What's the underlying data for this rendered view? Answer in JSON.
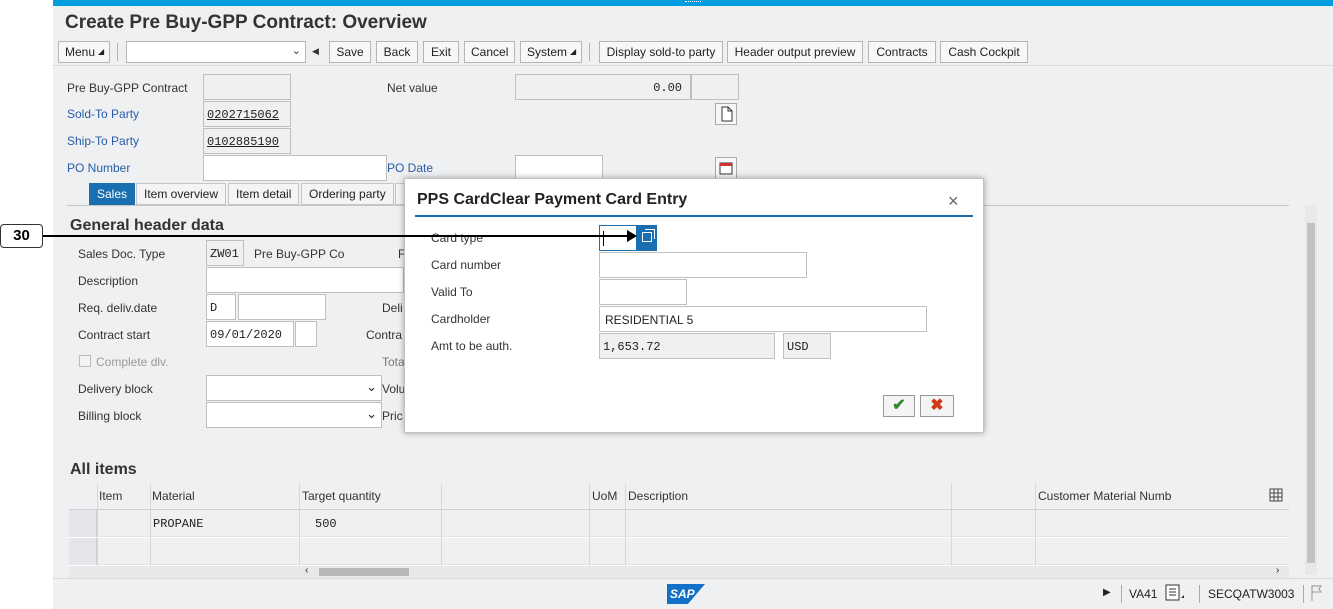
{
  "window": {
    "title": "Create Pre Buy-GPP Contract: Overview"
  },
  "toolbar": {
    "menu_label": "Menu",
    "save_label": "Save",
    "back_label": "Back",
    "exit_label": "Exit",
    "cancel_label": "Cancel",
    "system_label": "System",
    "display_sold_to_label": "Display sold-to party",
    "header_output_label": "Header output preview",
    "contracts_label": "Contracts",
    "cash_cockpit_label": "Cash Cockpit"
  },
  "header": {
    "contract_label": "Pre Buy-GPP Contract",
    "contract_value": "",
    "net_value_label": "Net value",
    "net_value": "0.00",
    "sold_to_label": "Sold-To Party",
    "sold_to_value": "0202715062",
    "ship_to_label": "Ship-To Party",
    "ship_to_value": "0102885190",
    "po_number_label": "PO Number",
    "po_date_label": "PO Date"
  },
  "tabs": [
    {
      "label": "Sales",
      "active": true
    },
    {
      "label": "Item overview"
    },
    {
      "label": "Item detail"
    },
    {
      "label": "Ordering party"
    }
  ],
  "general": {
    "title": "General header data",
    "sales_doc_type_label": "Sales Doc. Type",
    "sales_doc_type_value": "ZW01",
    "sales_doc_type_desc": "Pre Buy-GPP Co",
    "sales_doc_type_trail": "F",
    "description_label": "Description",
    "req_deliv_label": "Req. deliv.date",
    "req_deliv_value": "D",
    "deliv_trail": "Deli",
    "contract_start_label": "Contract start",
    "contract_start_value": "09/01/2020",
    "contract_trail": "Contra",
    "complete_dlv_label": "Complete dlv.",
    "total_trail": "Tota",
    "delivery_block_label": "Delivery block",
    "volume_trail": "Volu",
    "billing_block_label": "Billing block",
    "price_trail": "Pric"
  },
  "items": {
    "title": "All items",
    "columns": [
      "Item",
      "Material",
      "Target quantity",
      "UoM",
      "Description",
      "Customer Material Numb"
    ],
    "rows": [
      {
        "item": "",
        "material": "PROPANE",
        "qty": "500"
      }
    ]
  },
  "status": {
    "transaction": "VA41",
    "system": "SECQATW3003",
    "logo": "SAP"
  },
  "callout": {
    "label": "30"
  },
  "dialog": {
    "title": "PPS CardClear Payment Card Entry",
    "card_type_label": "Card type",
    "card_type_value": "",
    "card_number_label": "Card number",
    "card_number_value": "",
    "valid_to_label": "Valid To",
    "valid_to_value": "",
    "cardholder_label": "Cardholder",
    "cardholder_value": "RESIDENTIAL 5",
    "amount_label": "Amt to be auth.",
    "amount_value": "1,653.72",
    "currency_value": "USD",
    "ok_glyph": "✔",
    "cancel_glyph": "✖",
    "close_glyph": "×"
  }
}
